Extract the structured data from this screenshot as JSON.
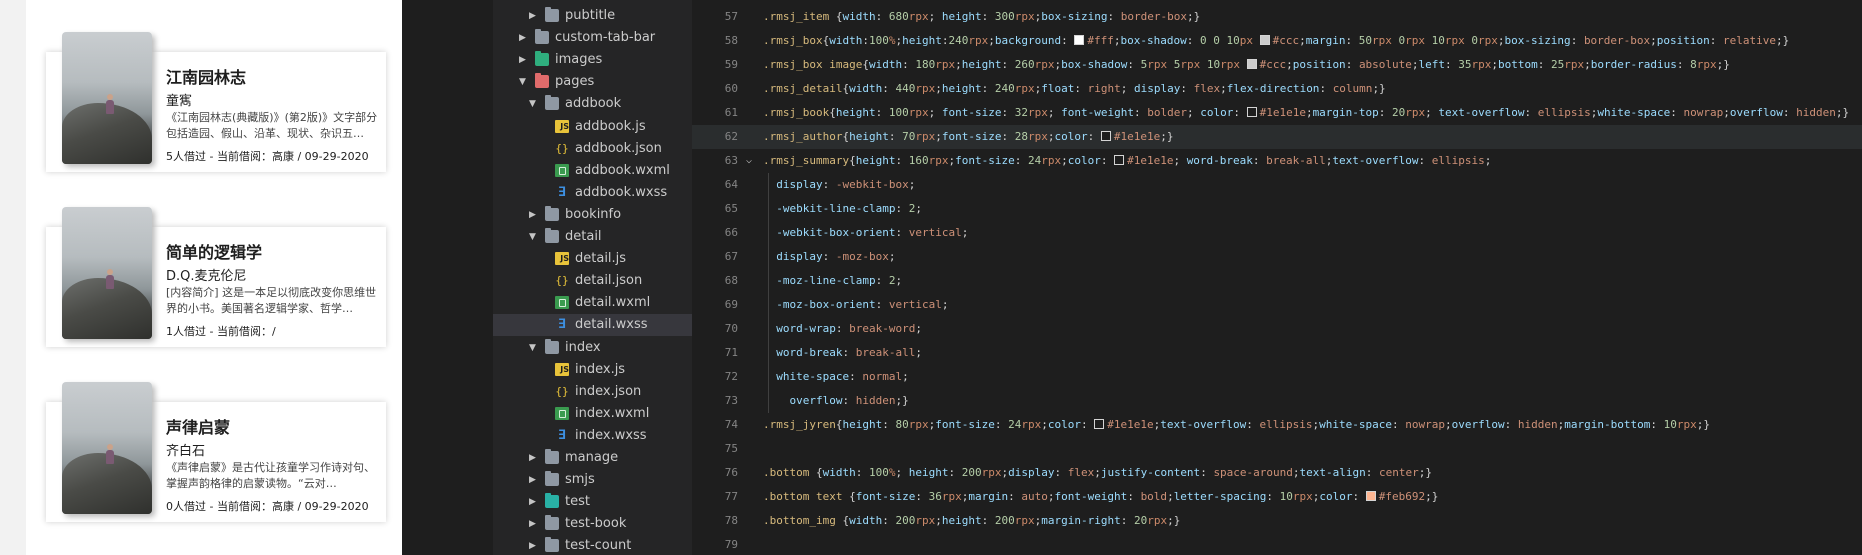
{
  "preview": {
    "books": [
      {
        "title": "江南园林志",
        "author": "童寯",
        "summary": "《江南园林志(典藏版)》(第2版)》文字部分包括造园、假山、沿革、现状、杂识五…",
        "stat": "5人借过  - 当前借阅：高康 / 09-29-2020"
      },
      {
        "title": "简单的逻辑学",
        "author": "D.Q.麦克伦尼",
        "summary": "[内容简介] 这是一本足以彻底改变你思维世界的小书。美国著名逻辑学家、哲学…",
        "stat": "1人借过  - 当前借阅：/"
      },
      {
        "title": "声律启蒙",
        "author": "齐白石",
        "summary": "《声律启蒙》是古代让孩童学习作诗对句、掌握声韵格律的启蒙读物。“云对…",
        "stat": "0人借过  - 当前借阅：高康 / 09-29-2020"
      }
    ]
  },
  "explorer": {
    "items": [
      {
        "label": "pubtitle",
        "kind": "folder",
        "expanded": false,
        "depth": 1
      },
      {
        "label": "custom-tab-bar",
        "kind": "folder",
        "expanded": false,
        "depth": 0
      },
      {
        "label": "images",
        "kind": "folder-green",
        "expanded": false,
        "depth": 0
      },
      {
        "label": "pages",
        "kind": "folder-red",
        "expanded": true,
        "depth": 0
      },
      {
        "label": "addbook",
        "kind": "folder",
        "expanded": true,
        "depth": 1
      },
      {
        "label": "addbook.js",
        "kind": "js",
        "depth": 2
      },
      {
        "label": "addbook.json",
        "kind": "json",
        "depth": 2
      },
      {
        "label": "addbook.wxml",
        "kind": "wxml",
        "depth": 2
      },
      {
        "label": "addbook.wxss",
        "kind": "wxss",
        "depth": 2
      },
      {
        "label": "bookinfo",
        "kind": "folder",
        "expanded": false,
        "depth": 1
      },
      {
        "label": "detail",
        "kind": "folder",
        "expanded": true,
        "depth": 1
      },
      {
        "label": "detail.js",
        "kind": "js",
        "depth": 2
      },
      {
        "label": "detail.json",
        "kind": "json",
        "depth": 2
      },
      {
        "label": "detail.wxml",
        "kind": "wxml",
        "depth": 2
      },
      {
        "label": "detail.wxss",
        "kind": "wxss",
        "depth": 2,
        "active": true
      },
      {
        "label": "index",
        "kind": "folder",
        "expanded": true,
        "depth": 1
      },
      {
        "label": "index.js",
        "kind": "js",
        "depth": 2
      },
      {
        "label": "index.json",
        "kind": "json",
        "depth": 2
      },
      {
        "label": "index.wxml",
        "kind": "wxml",
        "depth": 2
      },
      {
        "label": "index.wxss",
        "kind": "wxss",
        "depth": 2
      },
      {
        "label": "manage",
        "kind": "folder",
        "expanded": false,
        "depth": 1
      },
      {
        "label": "smjs",
        "kind": "folder",
        "expanded": false,
        "depth": 1
      },
      {
        "label": "test",
        "kind": "folder-teal",
        "expanded": false,
        "depth": 1
      },
      {
        "label": "test-book",
        "kind": "folder",
        "expanded": false,
        "depth": 1
      },
      {
        "label": "test-count",
        "kind": "folder",
        "expanded": false,
        "depth": 1
      }
    ]
  },
  "editor": {
    "current_line": 62,
    "lines": [
      {
        "n": "57",
        "code": ".rmsj_item {width: 680rpx; height: 300rpx;box-sizing: border-box;}"
      },
      {
        "n": "58",
        "code": ".rmsj_box{width:100%;height:240rpx;background: #fff;box-shadow: 0 0 10px #ccc;margin: 50rpx 0rpx 10rpx 0rpx;box-sizing: border-box;position: relative;}"
      },
      {
        "n": "59",
        "code": ".rmsj_box image{width: 180rpx;height: 260rpx;box-shadow: 5rpx 5rpx 10rpx #ccc;position: absolute;left: 35rpx;bottom: 25rpx;border-radius: 8rpx;}"
      },
      {
        "n": "60",
        "code": ".rmsj_detail{width: 440rpx;height: 240rpx;float: right; display: flex;flex-direction: column;}"
      },
      {
        "n": "61",
        "code": ".rmsj_book{height: 100rpx; font-size: 32rpx; font-weight: bolder; color: #1e1e1e;margin-top: 20rpx; text-overflow: ellipsis;white-space: nowrap;overflow: hidden;}"
      },
      {
        "n": "62",
        "code": ".rmsj_author{height: 70rpx;font-size: 28rpx;color: #1e1e1e;}"
      },
      {
        "n": "63",
        "code": ".rmsj_summary{height: 160rpx;font-size: 24rpx;color: #1e1e1e; word-break: break-all;text-overflow: ellipsis;"
      },
      {
        "n": "64",
        "code": "  display: -webkit-box;"
      },
      {
        "n": "65",
        "code": "  -webkit-line-clamp: 2;"
      },
      {
        "n": "66",
        "code": "  -webkit-box-orient: vertical;"
      },
      {
        "n": "67",
        "code": "  display: -moz-box;"
      },
      {
        "n": "68",
        "code": "  -moz-line-clamp: 2;"
      },
      {
        "n": "69",
        "code": "  -moz-box-orient: vertical;"
      },
      {
        "n": "70",
        "code": "  word-wrap: break-word;"
      },
      {
        "n": "71",
        "code": "  word-break: break-all;"
      },
      {
        "n": "72",
        "code": "  white-space: normal;"
      },
      {
        "n": "73",
        "code": "    overflow: hidden;}"
      },
      {
        "n": "74",
        "code": ".rmsj_jyren{height: 80rpx;font-size: 24rpx;color: #1e1e1e;text-overflow: ellipsis;white-space: nowrap;overflow: hidden;margin-bottom: 10rpx;}"
      },
      {
        "n": "75",
        "code": ""
      },
      {
        "n": "76",
        "code": ".bottom {width: 100%; height: 200rpx;display: flex;justify-content: space-around;text-align: center;}"
      },
      {
        "n": "77",
        "code": ".bottom text {font-size: 36rpx;margin: auto;font-weight: bold;letter-spacing: 10rpx;color: #feb692;}"
      },
      {
        "n": "78",
        "code": ".bottom_img {width: 200rpx;height: 200rpx;margin-right: 20rpx;}"
      },
      {
        "n": "79",
        "code": ""
      }
    ]
  },
  "colors": {
    "selector": "#d7ba7d",
    "property": "#9cdcfe",
    "number": "#b5cea8",
    "value": "#ce9178",
    "editor_bg": "#1e1e1e",
    "sidebar_bg": "#252526"
  }
}
